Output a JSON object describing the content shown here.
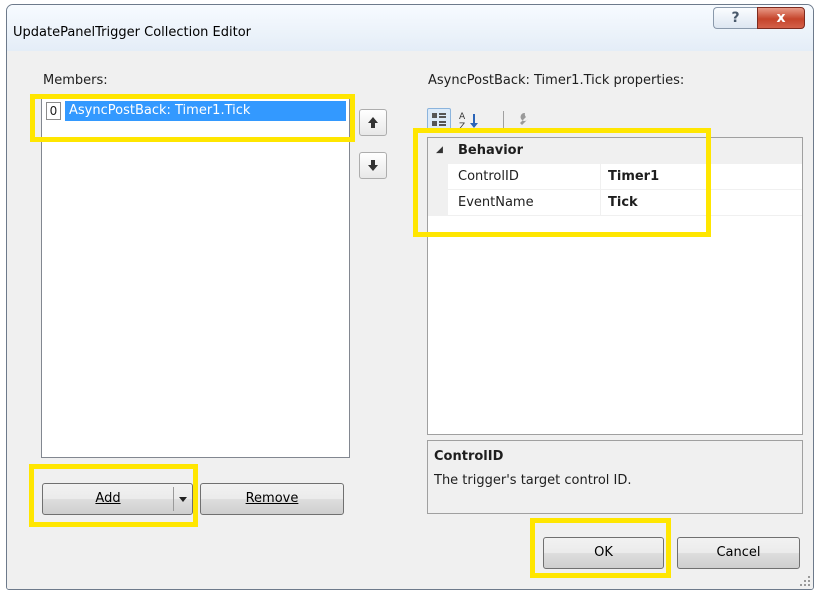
{
  "window": {
    "title": "UpdatePanelTrigger Collection Editor",
    "help_glyph": "?",
    "close_glyph": "x"
  },
  "members": {
    "label": "Members:",
    "items": [
      {
        "index": "0",
        "text": "AsyncPostBack: Timer1.Tick",
        "selected": true
      }
    ],
    "move_up_icon": "arrow-up-icon",
    "move_down_icon": "arrow-down-icon"
  },
  "buttons": {
    "add": "Add",
    "remove": "Remove",
    "ok": "OK",
    "cancel": "Cancel"
  },
  "properties": {
    "label": "AsyncPostBack: Timer1.Tick properties:",
    "toolbar": [
      "categorized-icon",
      "alphabetical-icon",
      "property-pages-icon"
    ],
    "category": {
      "name": "Behavior",
      "expanded": true,
      "toggle_glyph": "◢"
    },
    "rows": [
      {
        "name": "ControlID",
        "value": "Timer1"
      },
      {
        "name": "EventName",
        "value": "Tick"
      }
    ],
    "description": {
      "title": "ControlID",
      "text": "The trigger's target control ID."
    }
  },
  "colors": {
    "highlight": "#ffe600",
    "selection": "#3399ff",
    "close_button": "#c5442b"
  }
}
